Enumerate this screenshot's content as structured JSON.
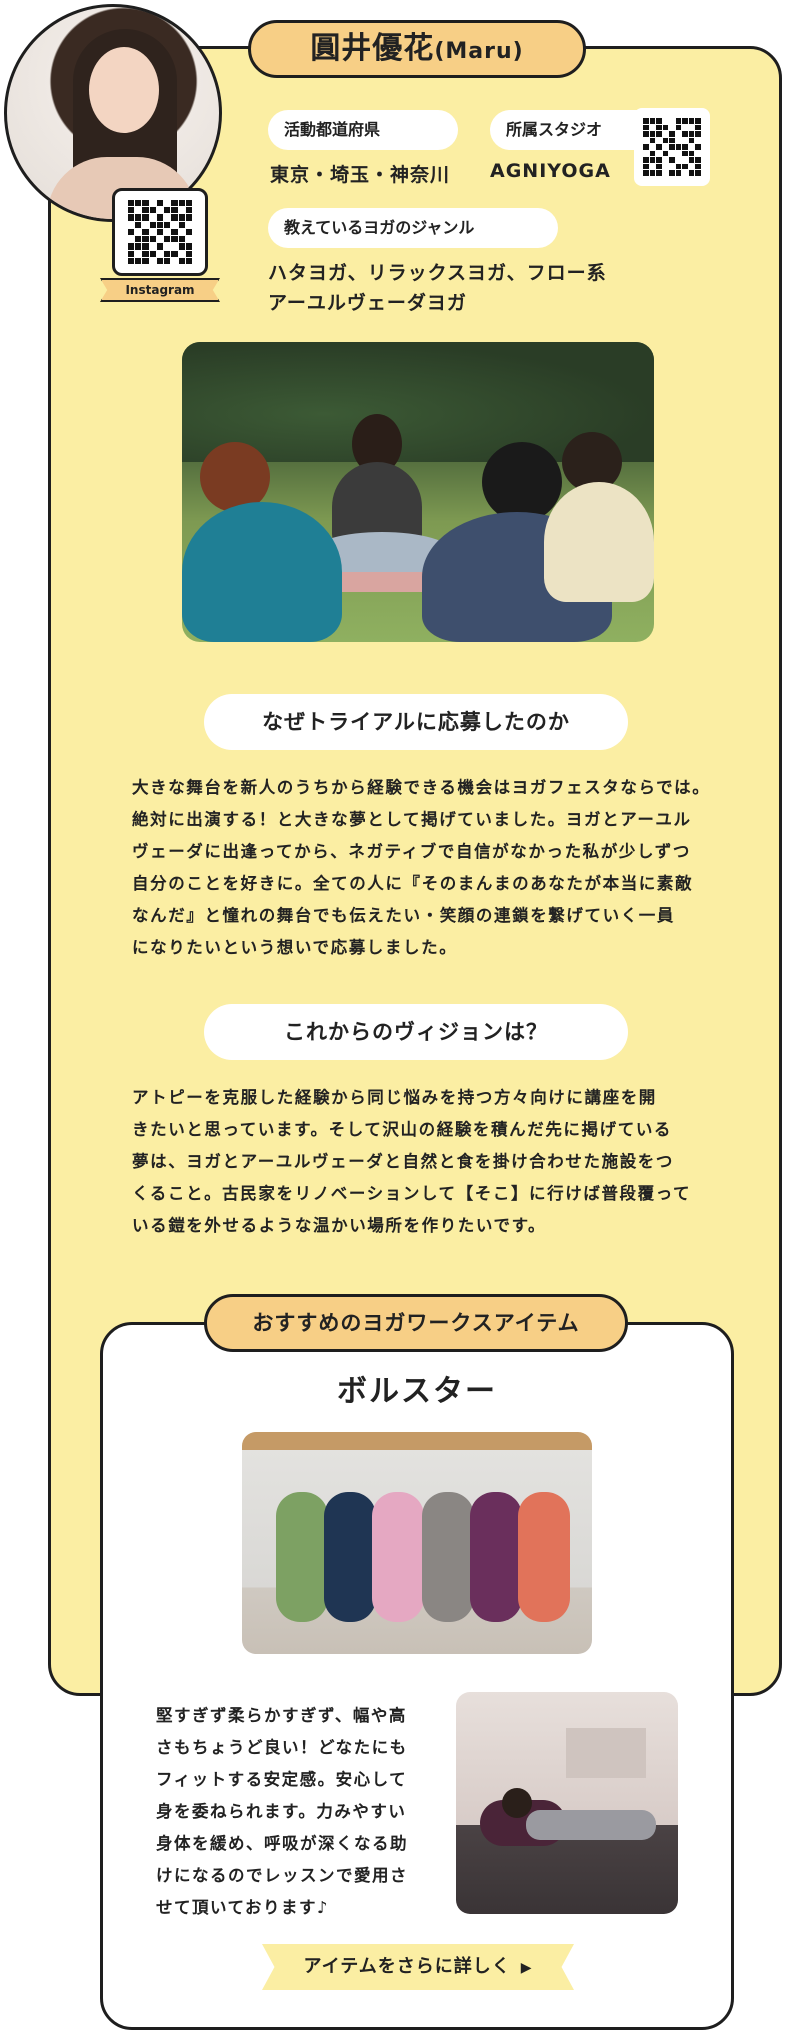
{
  "profile": {
    "name": "圓井優花",
    "name_roman": "(Maru)",
    "instagram_label": "Instagram",
    "region_label": "活動都道府県",
    "region_value": "東京・埼玉・神奈川",
    "studio_label": "所属スタジオ",
    "studio_value": "AGNIYOGA",
    "genre_label": "教えているヨガのジャンル",
    "genre_line1": "ハタヨガ、リラックスヨガ、フロー系",
    "genre_line2": "アーユルヴェーダヨガ"
  },
  "why": {
    "heading": "なぜトライアルに応募したのか",
    "lines": [
      "大きな舞台を新人のうちから経験できる機会はヨガフェスタならでは。",
      "絶対に出演する！と大きな夢として掲げていました。ヨガとアーユル",
      "ヴェーダに出逢ってから、ネガティブで自信がなかった私が少しずつ",
      "自分のことを好きに。全ての人に『そのまんまのあなたが本当に素敵",
      "なんだ』と憧れの舞台でも伝えたい・笑顔の連鎖を繋げていく一員",
      "になりたいという想いで応募しました。"
    ]
  },
  "vision": {
    "heading": "これからのヴィジョンは？",
    "lines": [
      "アトピーを克服した経験から同じ悩みを持つ方々向けに講座を開",
      "きたいと思っています。そして沢山の経験を積んだ先に掲げている",
      "夢は、ヨガとアーユルヴェーダと自然と食を掛け合わせた施設をつ",
      "くること。古民家をリノベーションして【そこ】に行けば普段覆って",
      "いる鎧を外せるような温かい場所を作りたいです。"
    ]
  },
  "item": {
    "tag": "おすすめのヨガワークスアイテム",
    "title": "ボルスター",
    "lines": [
      "堅すぎず柔らかすぎず、幅や高",
      "さもちょうど良い！どなたにも",
      "フィットする安定感。安心して",
      "身を委ねられます。力みやすい",
      "身体を緩め、呼吸が深くなる助",
      "けになるのでレッスンで愛用さ",
      "せて頂いております♪"
    ],
    "cta": "アイテムをさらに詳しく"
  },
  "colors": {
    "card_bg": "#fbeea3",
    "accent_orange": "#f7cf86",
    "border": "#1e1e1e",
    "bolsters": [
      "#7da163",
      "#1f3553",
      "#e5a8c2",
      "#8a8683",
      "#6a2f5c",
      "#e1735a"
    ]
  },
  "icons": {
    "qr": "qr-code-icon",
    "cta_arrow": "triangle-right-icon"
  }
}
